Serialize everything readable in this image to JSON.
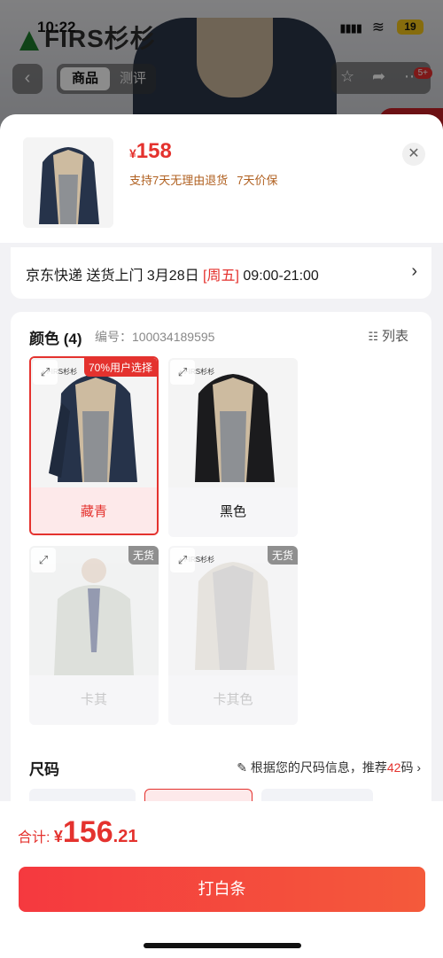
{
  "status_bar": {
    "time": "10:22",
    "battery": "19"
  },
  "background": {
    "brand_logo": "FIRS杉杉"
  },
  "nav": {
    "tabs": [
      {
        "label": "商品"
      },
      {
        "label": "测评"
      }
    ],
    "badge": "5+"
  },
  "sheet": {
    "price_currency": "¥",
    "price_value": "158",
    "promises": [
      "支持7天无理由退货",
      "7天价保"
    ],
    "delivery": {
      "prefix": "京东快递 送货上门 3月28日 ",
      "weekday": "[周五]",
      "time": " 09:00-21:00"
    },
    "color": {
      "title": "颜色 (4)",
      "item_no_label": "编号：",
      "item_no": "100034189595",
      "list_toggle": "列表",
      "swatches": [
        {
          "label": "藏青",
          "tag": "70%用户选择",
          "selected": true,
          "oos": false
        },
        {
          "label": "黑色",
          "tag": "",
          "selected": false,
          "oos": false
        },
        {
          "label": "卡其",
          "tag": "无货",
          "selected": false,
          "oos": true
        },
        {
          "label": "卡其色",
          "tag": "无货",
          "selected": false,
          "oos": true
        }
      ]
    },
    "size": {
      "title": "尺码",
      "hint_prefix": "根据您的尺码信息，推荐",
      "recommend": "42",
      "hint_suffix": "码"
    }
  },
  "bottom": {
    "total_label": "合计:",
    "currency": "¥",
    "total_int": "156",
    "total_dec": ".21",
    "buy_label": "打白条"
  },
  "colors": {
    "accent": "#e4322e",
    "promise": "#b06020"
  },
  "icons": {
    "back": "chevron-left-icon",
    "star": "star-icon",
    "share": "share-icon",
    "more": "more-icon",
    "close": "close-icon",
    "arrow": "chevron-right-icon",
    "expand": "expand-icon",
    "list": "list-icon",
    "ruler": "ruler-icon"
  }
}
